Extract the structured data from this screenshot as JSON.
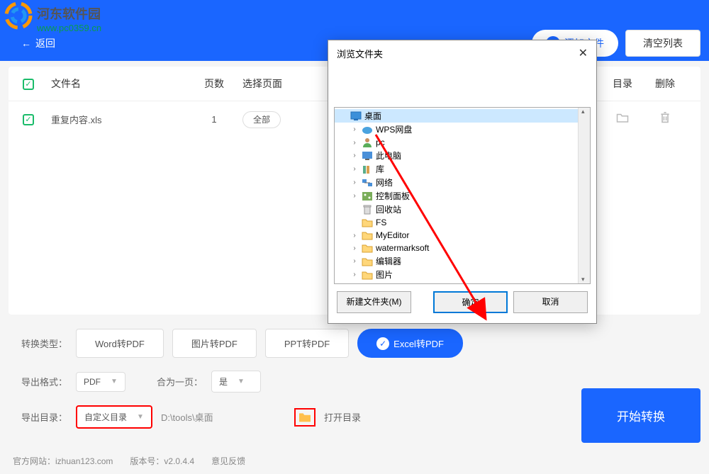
{
  "watermark": {
    "title": "河东软件园",
    "url": "www.pc0359.cn"
  },
  "header": {
    "back": "返回",
    "add_file": "添加文件",
    "clear_list": "清空列表"
  },
  "table": {
    "headers": {
      "name": "文件名",
      "pages": "页数",
      "select": "选择页面",
      "dir": "目录",
      "delete": "删除"
    },
    "rows": [
      {
        "name": "重复内容.xls",
        "pages": "1",
        "select": "全部"
      }
    ]
  },
  "options": {
    "type_label": "转换类型：",
    "types": [
      "Word转PDF",
      "图片转PDF",
      "PPT转PDF",
      "Excel转PDF"
    ],
    "format_label": "导出格式：",
    "format_value": "PDF",
    "merge_label": "合为一页：",
    "merge_value": "是",
    "outdir_label": "导出目录：",
    "outdir_mode": "自定义目录",
    "outdir_path": "D:\\tools\\桌面",
    "open_dir": "打开目录"
  },
  "convert_btn": "开始转换",
  "footer": {
    "site_label": "官方网站：",
    "site": "izhuan123.com",
    "version_label": "版本号：",
    "version": "v2.0.4.4",
    "feedback": "意见反馈"
  },
  "dialog": {
    "title": "浏览文件夹",
    "tree": [
      {
        "label": "桌面",
        "level": 0,
        "icon": "desktop",
        "selected": true,
        "expand": ""
      },
      {
        "label": "WPS网盘",
        "level": 1,
        "icon": "cloud",
        "expand": "›"
      },
      {
        "label": "pc",
        "level": 1,
        "icon": "user",
        "expand": "›"
      },
      {
        "label": "此电脑",
        "level": 1,
        "icon": "pc",
        "expand": "›"
      },
      {
        "label": "库",
        "level": 1,
        "icon": "lib",
        "expand": "›"
      },
      {
        "label": "网络",
        "level": 1,
        "icon": "net",
        "expand": "›"
      },
      {
        "label": "控制面板",
        "level": 1,
        "icon": "ctrl",
        "expand": "›"
      },
      {
        "label": "回收站",
        "level": 1,
        "icon": "bin",
        "expand": ""
      },
      {
        "label": "FS",
        "level": 1,
        "icon": "folder",
        "expand": ""
      },
      {
        "label": "MyEditor",
        "level": 1,
        "icon": "folder",
        "expand": "›"
      },
      {
        "label": "watermarksoft",
        "level": 1,
        "icon": "folder",
        "expand": "›"
      },
      {
        "label": "编辑器",
        "level": 1,
        "icon": "folder",
        "expand": "›"
      },
      {
        "label": "图片",
        "level": 1,
        "icon": "folder",
        "expand": "›"
      }
    ],
    "new_folder": "新建文件夹(M)",
    "ok": "确定",
    "cancel": "取消"
  }
}
